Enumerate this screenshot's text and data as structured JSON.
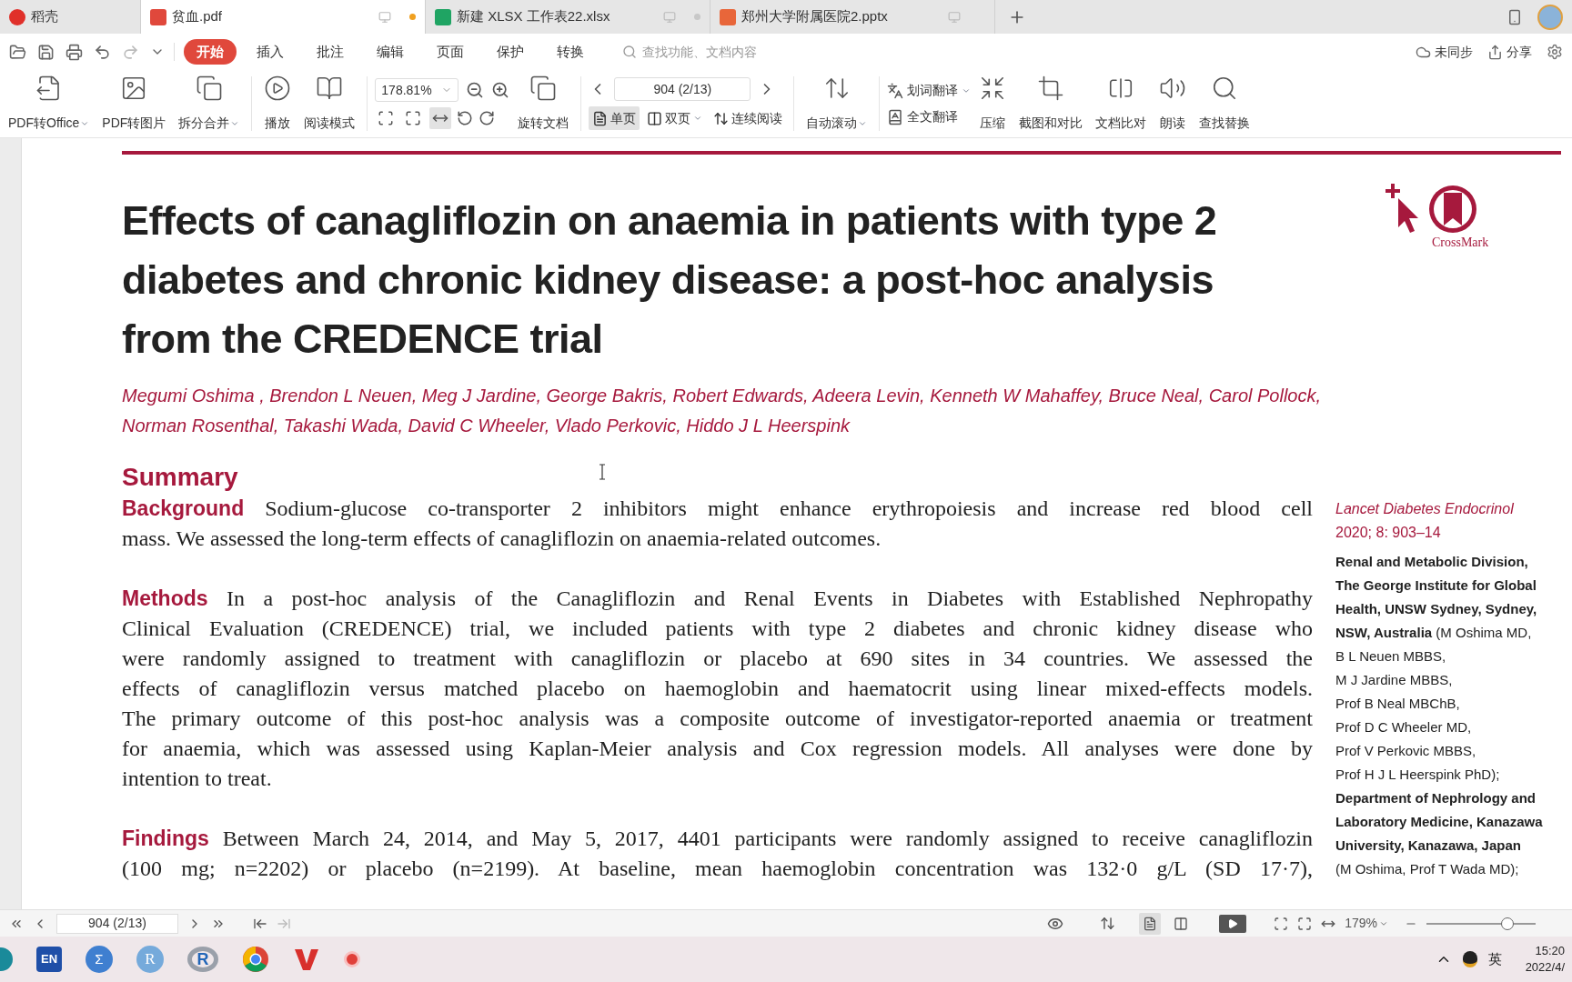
{
  "tabs": [
    {
      "kind": "docer",
      "label": "稻壳",
      "selected": false
    },
    {
      "kind": "pdf",
      "label": "贫血.pdf",
      "selected": true,
      "color": "#f0a020"
    },
    {
      "kind": "xlsx",
      "label": "新建 XLSX 工作表22.xlsx",
      "selected": false,
      "color": "#c8c8c8"
    },
    {
      "kind": "pptx",
      "label": "郑州大学附属医院2.pptx",
      "selected": false
    }
  ],
  "menu": {
    "items": [
      {
        "label": "开始",
        "selected": true
      },
      {
        "label": "插入",
        "selected": false
      },
      {
        "label": "批注",
        "selected": false
      },
      {
        "label": "编辑",
        "selected": false
      },
      {
        "label": "页面",
        "selected": false
      },
      {
        "label": "保护",
        "selected": false
      },
      {
        "label": "转换",
        "selected": false
      }
    ],
    "search": {
      "placeholder": "查找功能、文档内容"
    },
    "sync": "未同步",
    "share": "分享"
  },
  "toolbar": {
    "convert": [
      {
        "label": "PDF转Office",
        "dropdown": true
      },
      {
        "label": "PDF转图片",
        "dropdown": false
      },
      {
        "label": "拆分合并",
        "dropdown": true
      }
    ],
    "read": [
      {
        "label": "播放"
      },
      {
        "label": "阅读模式"
      }
    ],
    "zoom": "178.81%",
    "fit_modes": [
      {
        "selected": false
      },
      {
        "selected": false
      },
      {
        "selected": true
      }
    ],
    "rotate": "旋转文档",
    "page": "904 (2/13)",
    "views": [
      {
        "label": "单页",
        "selected": true,
        "dropdown": false
      },
      {
        "label": "双页",
        "selected": false,
        "dropdown": true
      },
      {
        "label": "连续阅读",
        "selected": false,
        "dropdown": false
      }
    ],
    "auto_scroll": {
      "label": "自动滚动",
      "dropdown": true
    },
    "translate": [
      {
        "label": "划词翻译",
        "dropdown": true
      },
      {
        "label": "全文翻译",
        "dropdown": false
      }
    ],
    "tools": [
      {
        "label": "压缩"
      },
      {
        "label": "截图和对比"
      },
      {
        "label": "文档比对"
      },
      {
        "label": "朗读"
      },
      {
        "label": "查找替换"
      }
    ]
  },
  "document": {
    "title": "Effects of canagliflozin on anaemia in patients with type 2 diabetes and chronic kidney disease: a post-hoc analysis from the CREDENCE trial",
    "crossmark": "CrossMark",
    "authors": "Megumi Oshima , Brendon L Neuen, Meg J Jardine, George Bakris, Robert Edwards, Adeera Levin, Kenneth W Mahaffey, Bruce Neal, Carol Pollock, Norman Rosenthal, Takashi Wada, David C Wheeler, Vlado Perkovic, Hiddo J L Heerspink",
    "summary_heading": "Summary",
    "sections": [
      {
        "heading": "Background",
        "continues": false,
        "lines": [
          "Sodium-glucose co-transporter 2 inhibitors might enhance erythropoiesis and increase red blood cell",
          "mass. We assessed the long-term effects of canagliflozin on anaemia-related outcomes."
        ]
      },
      {
        "heading": "Methods",
        "continues": false,
        "lines": [
          "In a post-hoc analysis of the Canagliflozin and Renal Events in Diabetes with Established Nephropathy",
          "Clinical Evaluation (CREDENCE) trial, we included patients with type 2 diabetes and chronic kidney disease who",
          "were randomly assigned to treatment with canagliflozin or placebo at 690 sites in 34 countries. We assessed the",
          "effects of canagliflozin versus matched placebo on haemoglobin and haematocrit using linear mixed-effects models.",
          "The primary outcome of this post-hoc analysis was a composite outcome of investigator-reported anaemia or treatment",
          "for anaemia, which was assessed using Kaplan-Meier analysis and Cox regression models. All analyses were done by",
          "intention to treat."
        ]
      },
      {
        "heading": "Findings",
        "continues": true,
        "lines": [
          "Between March 24, 2014, and May 5, 2017, 4401 participants were randomly assigned to receive canagliflozin",
          "(100 mg; n=2202) or placebo (n=2199). At baseline, mean haemoglobin concentration was 132·0 g/L (SD 17·7),"
        ]
      }
    ],
    "journal": [
      "Lancet Diabetes Endocrinol",
      "2020; 8: 903–14"
    ],
    "affiliations": [
      {
        "text": "Renal and Metabolic Division,",
        "bold": true
      },
      {
        "text": "The George Institute for Global",
        "bold": true
      },
      {
        "text": "Health, UNSW Sydney, Sydney,",
        "bold": true
      },
      {
        "text": "**NSW, Australia** (M Oshima MD,",
        "bold": false
      },
      {
        "text": "B L Neuen MBBS,",
        "bold": false
      },
      {
        "text": "M J Jardine MBBS,",
        "bold": false
      },
      {
        "text": "Prof B Neal MBChB,",
        "bold": false
      },
      {
        "text": "Prof D C Wheeler MD,",
        "bold": false
      },
      {
        "text": "Prof V Perkovic MBBS,",
        "bold": false
      },
      {
        "text": "Prof H J L Heerspink PhD);",
        "bold": false
      },
      {
        "text": "Department of Nephrology and",
        "bold": true
      },
      {
        "text": "Laboratory Medicine, Kanazawa",
        "bold": true
      },
      {
        "text": "University, Kanazawa, Japan",
        "bold": true
      },
      {
        "text": "(M Oshima, Prof T Wada MD);",
        "bold": false
      }
    ]
  },
  "status_bar": {
    "page": "904 (2/13)",
    "views": [
      {
        "selected": true
      },
      {
        "selected": false
      }
    ],
    "zoom": "179%",
    "zoom_slider": {
      "level": 0.74
    }
  },
  "taskbar": {
    "apps": [
      {
        "kind": "partial"
      },
      {
        "kind": "text",
        "label": "EN"
      },
      {
        "kind": "sigma",
        "label": "Σ"
      },
      {
        "kind": "rstudio",
        "label": "R"
      },
      {
        "kind": "r",
        "label": "R"
      },
      {
        "kind": "chrome"
      },
      {
        "kind": "wps"
      },
      {
        "kind": "record"
      }
    ],
    "ime": "英",
    "time": "15:20",
    "date": "2022/4/"
  }
}
